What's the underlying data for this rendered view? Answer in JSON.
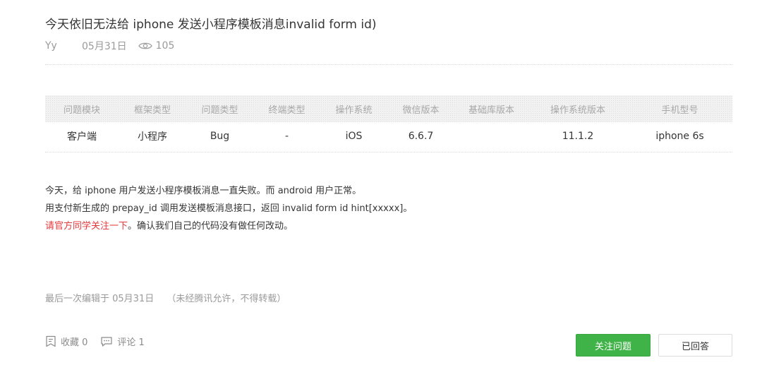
{
  "post": {
    "title": "今天依旧无法给 iphone 发送小程序模板消息invalid form id)",
    "author": "Yy",
    "date": "05月31日",
    "views": "105"
  },
  "info_table": {
    "headers": [
      "问题模块",
      "框架类型",
      "问题类型",
      "终端类型",
      "操作系统",
      "微信版本",
      "基础库版本",
      "操作系统版本",
      "手机型号"
    ],
    "values": [
      "客户端",
      "小程序",
      "Bug",
      "-",
      "iOS",
      "6.6.7",
      "",
      "11.1.2",
      "iphone 6s"
    ]
  },
  "content": {
    "line1": "今天，给 iphone 用户发送小程序模板消息一直失败。而 android 用户正常。",
    "line2": "用支付新生成的 prepay_id 调用发送模板消息接口，返回 invalid form id hint[xxxxx]。",
    "line3_highlight": "请官方同学关注一下",
    "line3_rest": "。确认我们自己的代码没有做任何改动。"
  },
  "footer": {
    "edited_label": "最后一次编辑于  05月31日",
    "edited_note": "（未经腾讯允许，不得转载）",
    "favorites_label": "收藏 0",
    "comments_label": "评论 1",
    "follow_button": "关注问题",
    "answered_button": "已回答"
  },
  "colors": {
    "accent_green": "#3fb347",
    "warn_red": "#e4393c"
  },
  "icons": [
    "eye-icon",
    "bookmark-icon",
    "comment-icon"
  ]
}
